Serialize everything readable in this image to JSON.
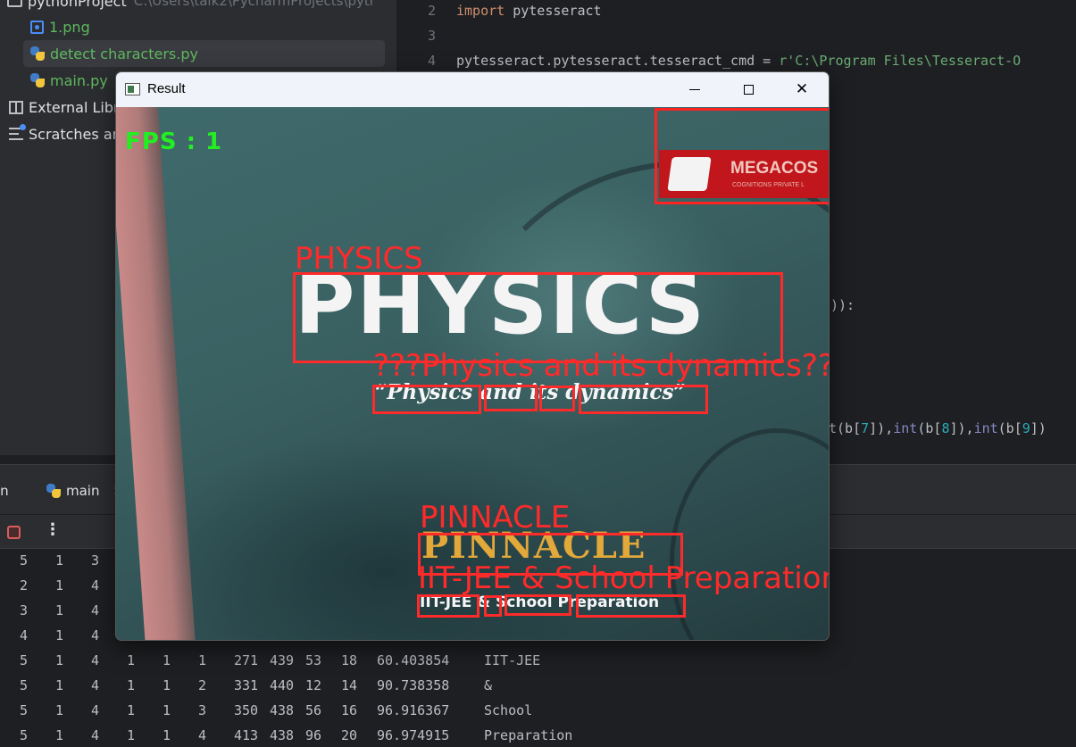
{
  "project": {
    "root_name": "pythonProject",
    "root_path": "C:\\Users\\talk2\\PycharmProjects\\pytr",
    "files": [
      {
        "name": "1.png",
        "icon": "image-file-icon"
      },
      {
        "name": "detect characters.py",
        "icon": "python-file-icon"
      },
      {
        "name": "main.py",
        "icon": "python-file-icon"
      }
    ],
    "external_libraries": "External Libr",
    "scratches": "Scratches ar"
  },
  "editor": {
    "line_numbers": [
      "2",
      "3",
      "4"
    ],
    "line2": {
      "kw": "import",
      "rest": " pytesseract"
    },
    "line4": {
      "code": "pytesseract.pytesseract.tesseract_cmd = ",
      "str": "r'C:\\Program Files\\Tesseract-O"
    },
    "frag_a": ")):",
    "frag_b": {
      "p1": "t(b[",
      "n1": "7",
      "p2": "]),",
      "f2": "int",
      "p3": "(b[",
      "n2": "8",
      "p4": "]),",
      "f3": "int",
      "p5": "(b[",
      "n3": "9",
      "p6": "])"
    }
  },
  "run": {
    "label": "ın",
    "tab": "main",
    "tab_close": "×",
    "more": "⋮",
    "rows": [
      [
        "5",
        "1",
        "3",
        "",
        "",
        "",
        "",
        "",
        "",
        "",
        "",
        ""
      ],
      [
        "2",
        "1",
        "4",
        "",
        "",
        "",
        "",
        "",
        "",
        "",
        "",
        ""
      ],
      [
        "3",
        "1",
        "4",
        "",
        "",
        "",
        "",
        "",
        "",
        "",
        "",
        ""
      ],
      [
        "4",
        "1",
        "4",
        "",
        "",
        "",
        "",
        "",
        "",
        "",
        "",
        ""
      ],
      [
        "5",
        "1",
        "4",
        "1",
        "1",
        "1",
        "271",
        "439",
        "53",
        "18",
        "60.403854",
        "IIT-JEE"
      ],
      [
        "5",
        "1",
        "4",
        "1",
        "1",
        "2",
        "331",
        "440",
        "12",
        "14",
        "90.738358",
        "&"
      ],
      [
        "5",
        "1",
        "4",
        "1",
        "1",
        "3",
        "350",
        "438",
        "56",
        "16",
        "96.916367",
        "School"
      ],
      [
        "5",
        "1",
        "4",
        "1",
        "1",
        "4",
        "413",
        "438",
        "96",
        "20",
        "96.974915",
        "Preparation"
      ]
    ]
  },
  "result_window": {
    "title": "Result",
    "fps": "FPS : 1",
    "physics_print": "PHYSICS",
    "physics_detected": "PHYSICS",
    "tagline_print": "“Physics and its dynamics”",
    "tagline_detected": "???Physics and its dynamics???",
    "pinnacle_print": "PINNACLE",
    "pinnacle_detected": "PINNACLE",
    "iit_print": "IIT-JEE & School Preparation",
    "iit_detected": "IIT-JEE & School Preparation",
    "megacos_name": "MEGACOS",
    "megacos_sub": "COGNITIONS PRIVATE L",
    "box_color": "#ff2a2a",
    "fps_color": "#22ee22"
  }
}
